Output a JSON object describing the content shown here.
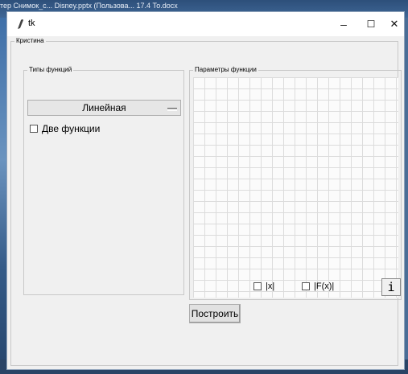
{
  "desktop": {
    "top_text": "тер   Снимок_с...   Disney.pptx   (Пользова...                  17.4 То.docx",
    "bottom_text": "..."
  },
  "window": {
    "title": "tk",
    "controls": {
      "minimize": "–",
      "maximize": "☐",
      "close": "✕"
    }
  },
  "outer_frame": {
    "label": "Кристина"
  },
  "function_types": {
    "label": "Типы функций",
    "combo_value": "Линейная",
    "two_functions_label": "Две функции",
    "two_functions_checked": false
  },
  "function_params": {
    "label": "Параметры функции",
    "abs_x_label": "|x|",
    "abs_fx_label": "|F(x)|",
    "abs_x_checked": false,
    "abs_fx_checked": false,
    "info_glyph": "i"
  },
  "actions": {
    "build_label": "Построить"
  }
}
